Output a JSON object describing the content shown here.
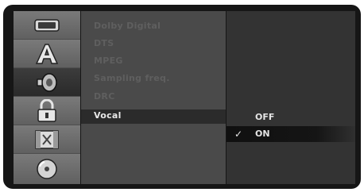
{
  "sidebar": {
    "icons": [
      {
        "name": "disc-settings-icon",
        "active": false
      },
      {
        "name": "language-icon",
        "active": false
      },
      {
        "name": "audio-icon",
        "active": true
      },
      {
        "name": "lock-icon",
        "active": false
      },
      {
        "name": "recording-icon",
        "active": false
      },
      {
        "name": "disc-icon",
        "active": false
      }
    ]
  },
  "submenu": {
    "items": [
      {
        "label": "Dolby Digital",
        "active": false
      },
      {
        "label": "DTS",
        "active": false
      },
      {
        "label": "MPEG",
        "active": false
      },
      {
        "label": "Sampling freq.",
        "active": false
      },
      {
        "label": "DRC",
        "active": false
      },
      {
        "label": "Vocal",
        "active": true
      }
    ]
  },
  "options": {
    "items": [
      {
        "label": "OFF",
        "selected": false
      },
      {
        "label": "ON",
        "selected": true
      }
    ],
    "check_glyph": "✓"
  },
  "colors": {
    "frame": "#161616",
    "icon_column": "#6a6a6a",
    "submenu_bg": "#4a4a4a",
    "option_bg": "#333333",
    "active_text": "#e9e9e9",
    "inactive_text": "#5f5f5f"
  }
}
